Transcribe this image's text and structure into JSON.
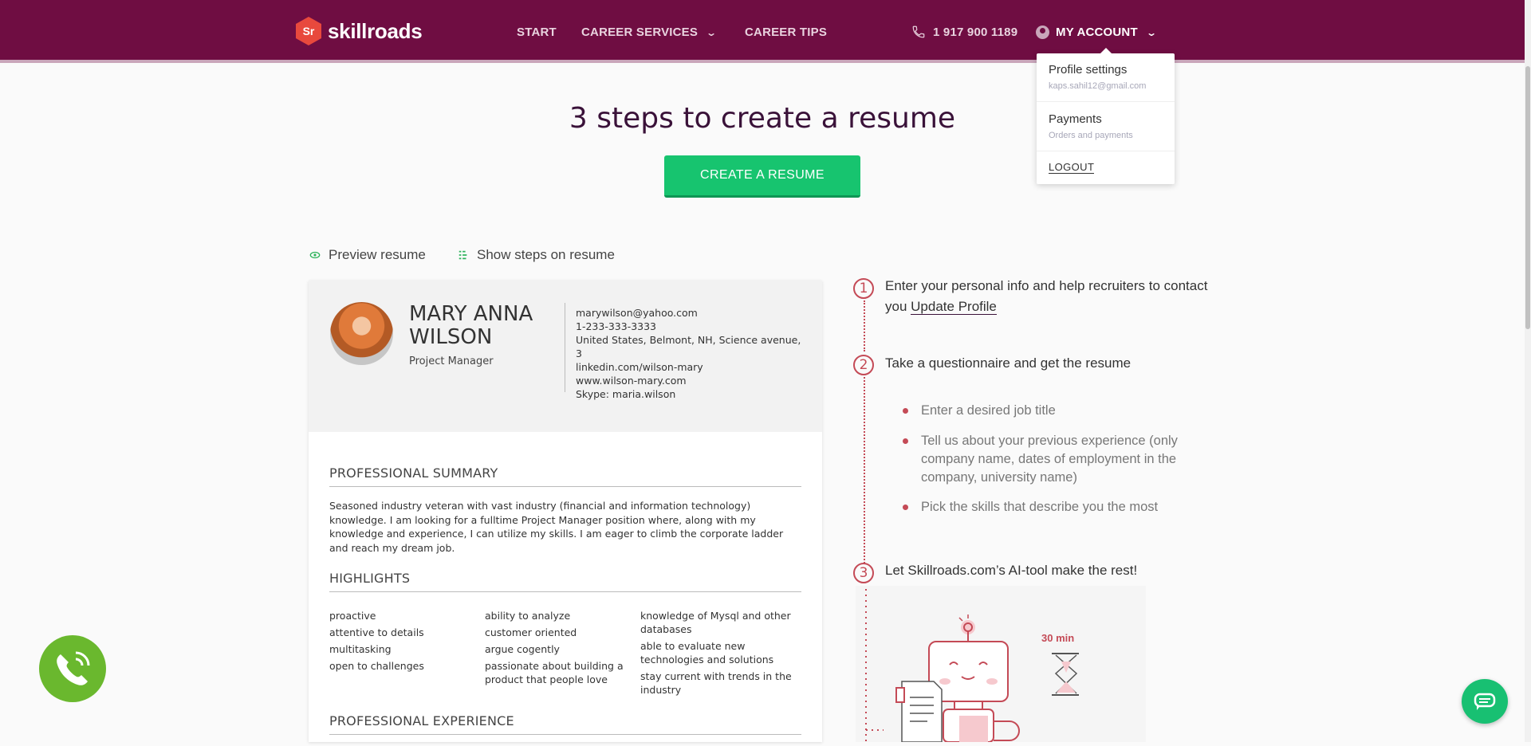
{
  "header": {
    "logo_mark": "Sr",
    "logo_text": "skillroads",
    "nav": {
      "start": "START",
      "career_services": "CAREER SERVICES",
      "career_tips": "CAREER TIPS"
    },
    "phone": "1 917 900 1189",
    "account": "MY ACCOUNT"
  },
  "account_menu": {
    "profile_title": "Profile settings",
    "profile_email": "kaps.sahil12@gmail.com",
    "payments_title": "Payments",
    "payments_sub": "Orders and payments",
    "logout": "LOGOUT"
  },
  "main": {
    "heading": "3 steps to create a resume",
    "cta": "CREATE A RESUME",
    "preview_toggle": "Preview resume",
    "steps_toggle": "Show steps on resume"
  },
  "resume": {
    "name_line1": "MARY ANNA",
    "name_line2": "WILSON",
    "role": "Project Manager",
    "contacts": [
      "marywilson@yahoo.com",
      "1-233-333-3333",
      "United States, Belmont, NH, Science avenue, 3",
      "linkedin.com/wilson-mary",
      "www.wilson-mary.com",
      "Skype: maria.wilson"
    ],
    "summary_title": "PROFESSIONAL SUMMARY",
    "summary_text": "Seasoned industry veteran with vast industry (financial and information technology) knowledge. I am looking for a fulltime Project Manager position where, along with my knowledge and experience, I can utilize my skills. I am eager to climb the corporate ladder and reach my dream job.",
    "highlights_title": "HIGHLIGHTS",
    "highlights_col1": [
      "proactive",
      "attentive to details",
      "multitasking",
      "open to challenges"
    ],
    "highlights_col2": [
      "ability to analyze",
      "customer oriented",
      "argue cogently",
      "passionate about building a product that people love"
    ],
    "highlights_col3": [
      "knowledge of Mysql and other databases",
      "able to evaluate new technologies and solutions",
      "stay current with trends in the industry"
    ],
    "experience_title": "PROFESSIONAL EXPERIENCE"
  },
  "steps": {
    "s1_num": "1",
    "s1_text": "Enter your personal info and help recruiters to contact you",
    "s1_link": "Update Profile",
    "s2_num": "2",
    "s2_text": "Take a questionnaire and get the resume",
    "s2_bullets": [
      "Enter a desired job title",
      "Tell us about your previous experience (only company name, dates of employment in the company, university name)",
      "Pick the skills that describe you the most"
    ],
    "s3_num": "3",
    "s3_text": "Let Skillroads.com’s AI-tool make the rest!",
    "illustration_time": "30 min"
  },
  "colors": {
    "brand": "#6f0d42",
    "cta": "#17c46f",
    "accent": "#c44a56"
  }
}
